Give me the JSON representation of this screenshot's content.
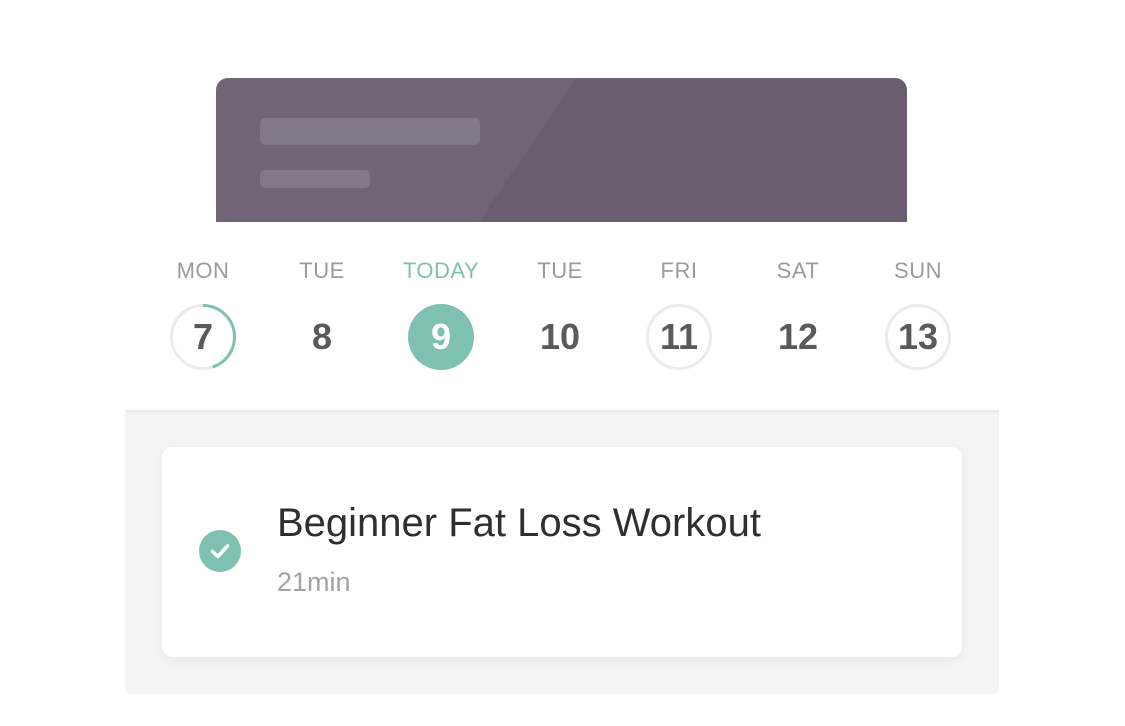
{
  "colors": {
    "accent": "#7ec0b2",
    "banner": "#6a5d70",
    "muted_text": "#9b9b9b",
    "day_number": "#5a5a5a",
    "title_text": "#2f2f2f",
    "ring": "#ebebeb"
  },
  "week": {
    "days": [
      {
        "label": "MON",
        "number": "7",
        "state": "partial",
        "progress": 0.45
      },
      {
        "label": "TUE",
        "number": "8",
        "state": "none"
      },
      {
        "label": "TODAY",
        "number": "9",
        "state": "today"
      },
      {
        "label": "TUE",
        "number": "10",
        "state": "none"
      },
      {
        "label": "FRI",
        "number": "11",
        "state": "ring"
      },
      {
        "label": "SAT",
        "number": "12",
        "state": "none"
      },
      {
        "label": "SUN",
        "number": "13",
        "state": "ring"
      }
    ]
  },
  "workout": {
    "title": "Beginner Fat Loss Workout",
    "duration": "21min",
    "completed": true,
    "status_icon": "check-circle-icon"
  }
}
